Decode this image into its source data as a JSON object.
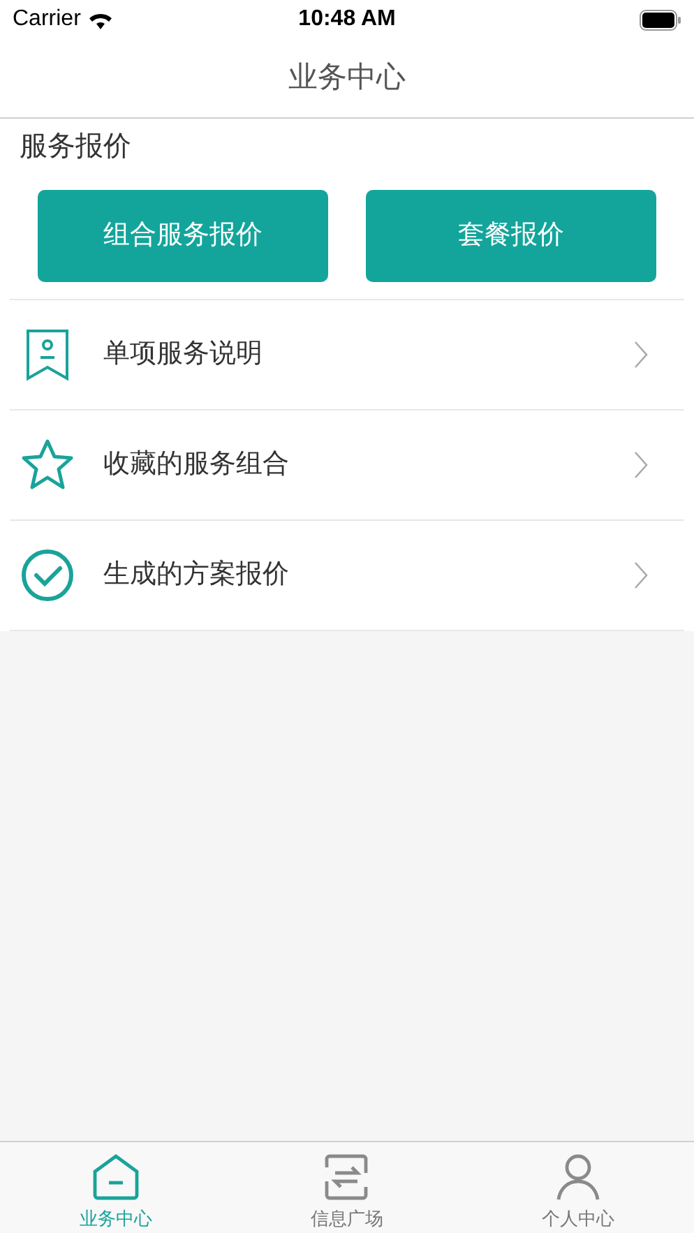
{
  "status_bar": {
    "carrier": "Carrier",
    "time": "10:48 AM"
  },
  "nav": {
    "title": "业务中心"
  },
  "section": {
    "title": "服务报价",
    "buttons": [
      "组合服务报价",
      "套餐报价"
    ]
  },
  "menu": [
    {
      "kind": "bookmark",
      "label": "单项服务说明"
    },
    {
      "kind": "star",
      "label": "收藏的服务组合"
    },
    {
      "kind": "check",
      "label": "生成的方案报价"
    }
  ],
  "tabs": [
    {
      "kind": "home",
      "label": "业务中心",
      "selected": true
    },
    {
      "kind": "exchange",
      "label": "信息广场",
      "selected": false
    },
    {
      "kind": "person",
      "label": "个人中心",
      "selected": false
    }
  ]
}
